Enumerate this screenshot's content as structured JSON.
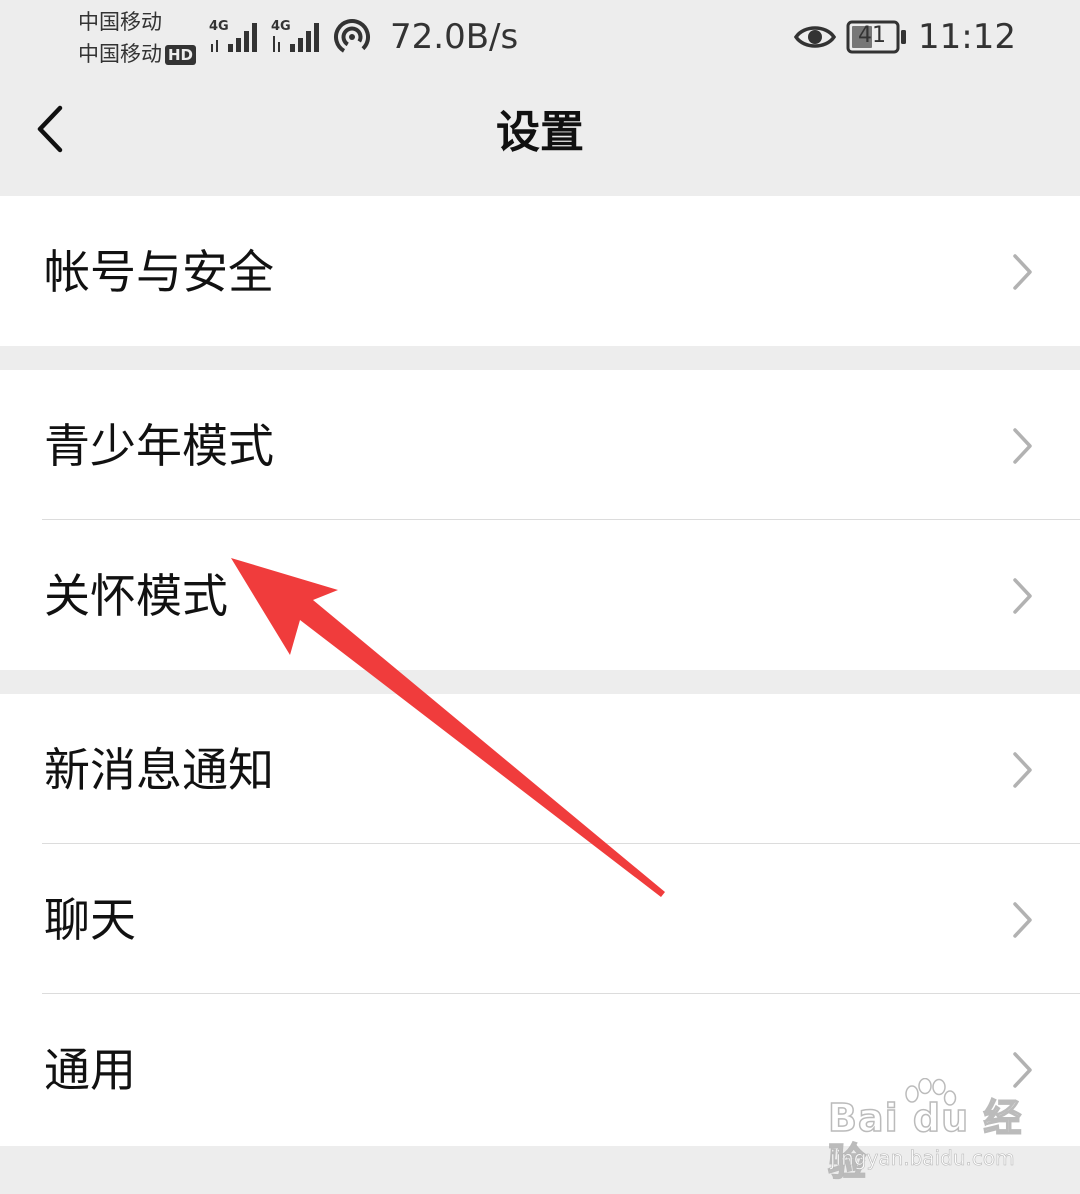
{
  "status_bar": {
    "carrier_1": "中国移动",
    "carrier_2": "中国移动",
    "hd_badge": "HD",
    "signal_1_label": "4G",
    "signal_2_label": "4G",
    "net_speed": "72.0B/s",
    "battery_level": "41",
    "time": "11:12",
    "icons": [
      "signal-icon",
      "signal-icon",
      "hotspot-icon",
      "eye-icon",
      "battery-icon"
    ]
  },
  "nav": {
    "title": "设置",
    "back_icon": "back-chevron-icon"
  },
  "groups": [
    {
      "items": [
        {
          "label": "帐号与安全"
        }
      ]
    },
    {
      "items": [
        {
          "label": "青少年模式"
        },
        {
          "label": "关怀模式"
        }
      ]
    },
    {
      "items": [
        {
          "label": "新消息通知"
        },
        {
          "label": "聊天"
        },
        {
          "label": "通用"
        }
      ]
    }
  ],
  "annotation": {
    "color": "#f03c3c",
    "icon": "red-arrow-annotation"
  },
  "watermark": {
    "logo_text": "Bai du 经验",
    "url": "jingyan.baidu.com"
  },
  "colors": {
    "background": "#ededed",
    "card": "#ffffff",
    "text": "#111111",
    "divider": "#dcdcdc",
    "chevron": "#b2b2b2"
  }
}
